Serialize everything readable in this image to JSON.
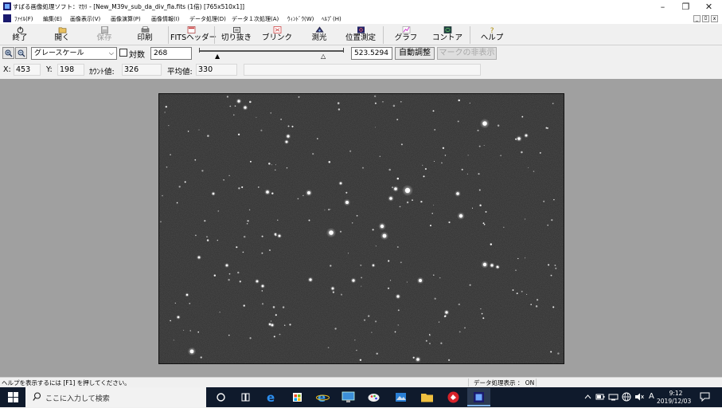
{
  "window": {
    "title": "すばる画像処理ソフト：ﾏｶﾘ - [New_M39v_sub_da_div_fla.fits (1倍) [765x510x1]]",
    "controls": {
      "minimize": "–",
      "restore": "❐",
      "close": "✕"
    }
  },
  "menu": {
    "items": [
      "ﾌｧｲﾙ(F)",
      "編集(E)",
      "画像表示(V)",
      "画像演算(P)",
      "画像情報(I)",
      "データ処理(D)",
      "データ１次処理(A)",
      "ｳｨﾝﾄﾞｳ(W)",
      "ﾍﾙﾌﾟ(H)"
    ],
    "mdi_controls": {
      "minimize": "_",
      "restore": "ﾛ",
      "close": "x"
    }
  },
  "toolbar": {
    "buttons": [
      {
        "label": "終了",
        "icon": "power-icon",
        "enabled": true
      },
      {
        "label": "開く",
        "icon": "folder-open-icon",
        "enabled": true
      },
      {
        "label": "保存",
        "icon": "save-icon",
        "enabled": false
      },
      {
        "label": "印刷",
        "icon": "printer-icon",
        "enabled": true
      },
      {
        "label": "FITSヘッダー",
        "icon": "fits-header-icon",
        "enabled": true
      },
      {
        "label": "切り抜き",
        "icon": "crop-icon",
        "enabled": true
      },
      {
        "label": "ブリンク",
        "icon": "blink-icon",
        "enabled": true
      },
      {
        "label": "測光",
        "icon": "photometry-icon",
        "enabled": true
      },
      {
        "label": "位置測定",
        "icon": "position-icon",
        "enabled": true
      },
      {
        "label": "グラフ",
        "icon": "graph-icon",
        "enabled": true
      },
      {
        "label": "コントア",
        "icon": "contour-icon",
        "enabled": true
      },
      {
        "label": "ヘルプ",
        "icon": "help-icon",
        "enabled": true
      }
    ]
  },
  "display_controls": {
    "colormap": "グレースケール",
    "log_label": "対数",
    "log_checked": false,
    "min_value": "268",
    "max_value": "523.5294",
    "auto_adjust_label": "自動調整",
    "hide_marks_label": "マークの非表示"
  },
  "info": {
    "x_label": "X:",
    "x_value": "453",
    "y_label": "Y:",
    "y_value": "198",
    "count_label": "ｶｳﾝﾄ値:",
    "count_value": "326",
    "mean_label": "平均値:",
    "mean_value": "330"
  },
  "status": {
    "help_text": "ヘルプを表示するには [F1] を押してください。",
    "data_label": "データ処理表示 ： ON"
  },
  "taskbar": {
    "search_placeholder": "ここに入力して検索",
    "apps": [
      "task-view",
      "edge-new",
      "store",
      "edge-legacy",
      "monitor",
      "paint",
      "photos",
      "explorer",
      "app-red",
      "makali"
    ],
    "tray": {
      "ime": "A"
    },
    "clock_time": "9:12",
    "clock_date": "2019/12/03"
  },
  "colors": {
    "background_gray": "#a0a0a0",
    "image_background": "#2b2b2b",
    "taskbar": "#0f1a2c"
  }
}
